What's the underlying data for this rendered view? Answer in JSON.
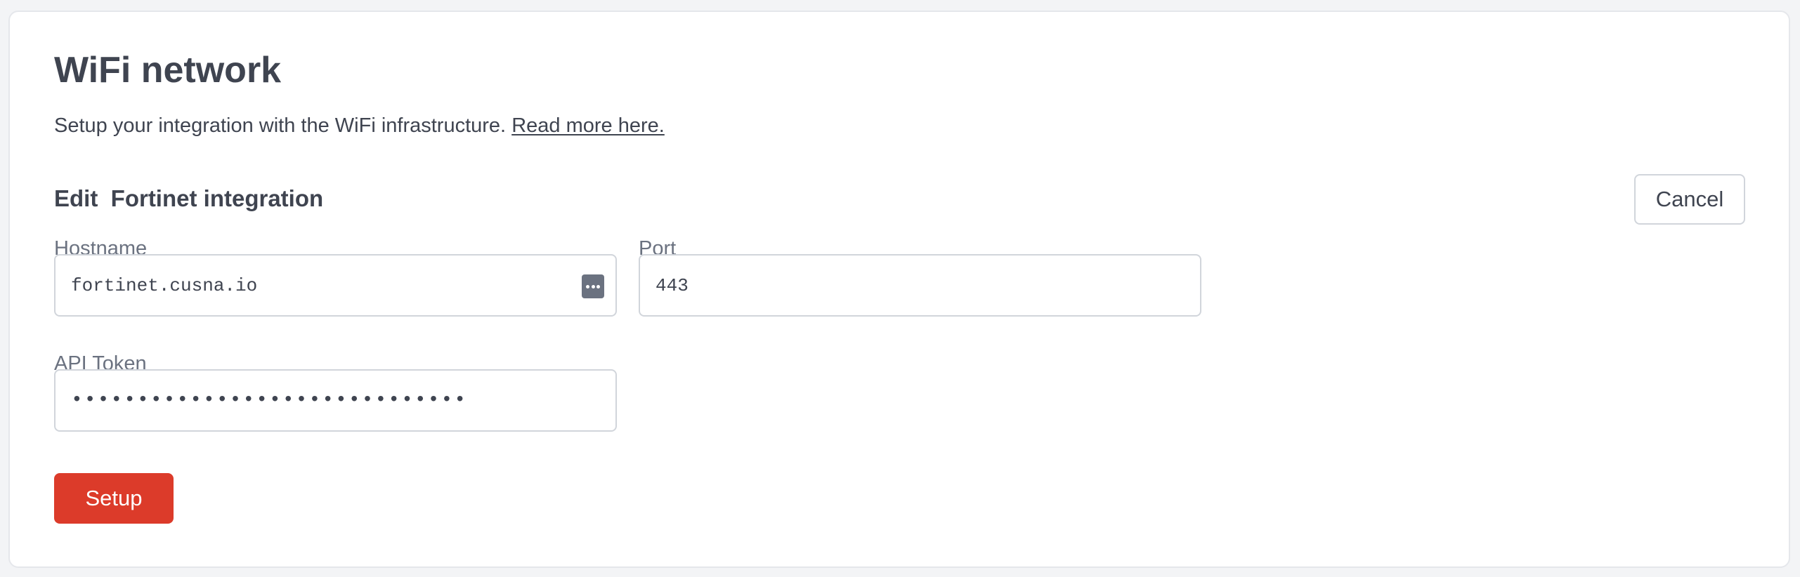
{
  "page": {
    "title": "WiFi network",
    "subtitle": "Setup your integration with the WiFi infrastructure.",
    "read_more_link": "Read more here."
  },
  "form": {
    "section_title": "Edit  Fortinet integration",
    "cancel_label": "Cancel",
    "hostname": {
      "label": "Hostname",
      "value": "fortinet.cusna.io"
    },
    "port": {
      "label": "Port",
      "value": "443"
    },
    "api_token": {
      "label": "API Token",
      "masked_value": "••••••••••••••••••••••••••••••"
    },
    "setup_label": "Setup"
  },
  "icons": {
    "password_manager": "more-horizontal-icon"
  },
  "colors": {
    "primary_button": "#dc3b2a",
    "text": "#3f4450",
    "muted_label": "#6b7280",
    "border": "#d1d5db"
  }
}
